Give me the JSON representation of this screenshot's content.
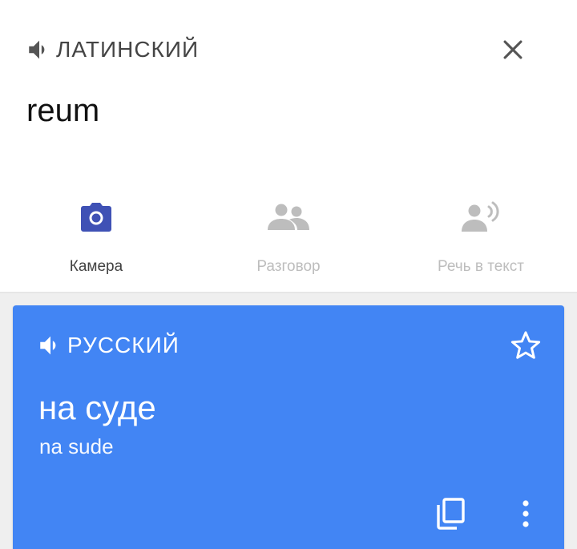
{
  "source": {
    "language": "ЛАТИНСКИЙ",
    "text": "reum"
  },
  "tools": [
    {
      "label": "Камера",
      "icon": "camera-icon",
      "active": true
    },
    {
      "label": "Разговор",
      "icon": "conversation-icon",
      "active": false
    },
    {
      "label": "Речь в текст",
      "icon": "voice-to-text-icon",
      "active": false
    }
  ],
  "result": {
    "language": "РУССКИЙ",
    "text": "на суде",
    "transliteration": "na sude"
  },
  "colors": {
    "accent": "#4285f4",
    "camera_icon": "#3f51b5",
    "inactive_icon": "#bdbdbd"
  }
}
